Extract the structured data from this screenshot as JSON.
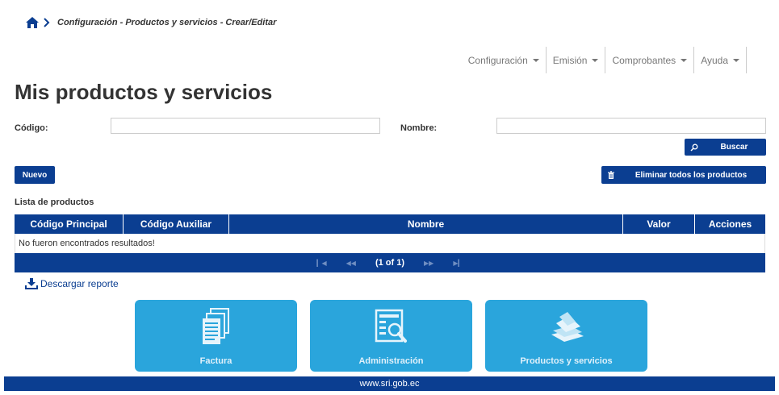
{
  "breadcrumb": {
    "icon": "home-icon",
    "separator_icon": "chevron-right-icon",
    "text": "Configuración - Productos y servicios - Crear/Editar"
  },
  "nav": {
    "items": [
      {
        "label": "Configuración"
      },
      {
        "label": "Emisión"
      },
      {
        "label": "Comprobantes"
      },
      {
        "label": "Ayuda"
      }
    ]
  },
  "page": {
    "title": "Mis productos y servicios"
  },
  "filters": {
    "codigo_label": "Código:",
    "codigo_value": "",
    "nombre_label": "Nombre:",
    "nombre_value": ""
  },
  "buttons": {
    "buscar": "Buscar",
    "nuevo": "Nuevo",
    "eliminar_todos": "Eliminar todos los productos"
  },
  "list": {
    "title": "Lista de productos",
    "columns": [
      "Código Principal",
      "Código Auxiliar",
      "Nombre",
      "Valor",
      "Acciones"
    ],
    "empty_message": "No fueron encontrados resultados!",
    "pagination": "(1 of 1)"
  },
  "download": {
    "label": "Descargar reporte",
    "icon": "download-icon"
  },
  "tiles": [
    {
      "label": "Factura",
      "icon": "documents-icon"
    },
    {
      "label": "Administración",
      "icon": "search-document-icon"
    },
    {
      "label": "Productos y servicios",
      "icon": "papers-stack-icon"
    }
  ],
  "footer": {
    "text": "www.sri.gob.ec"
  },
  "colors": {
    "primary": "#0b3e91",
    "tile": "#2aa5dc",
    "border": "#cccccc"
  }
}
